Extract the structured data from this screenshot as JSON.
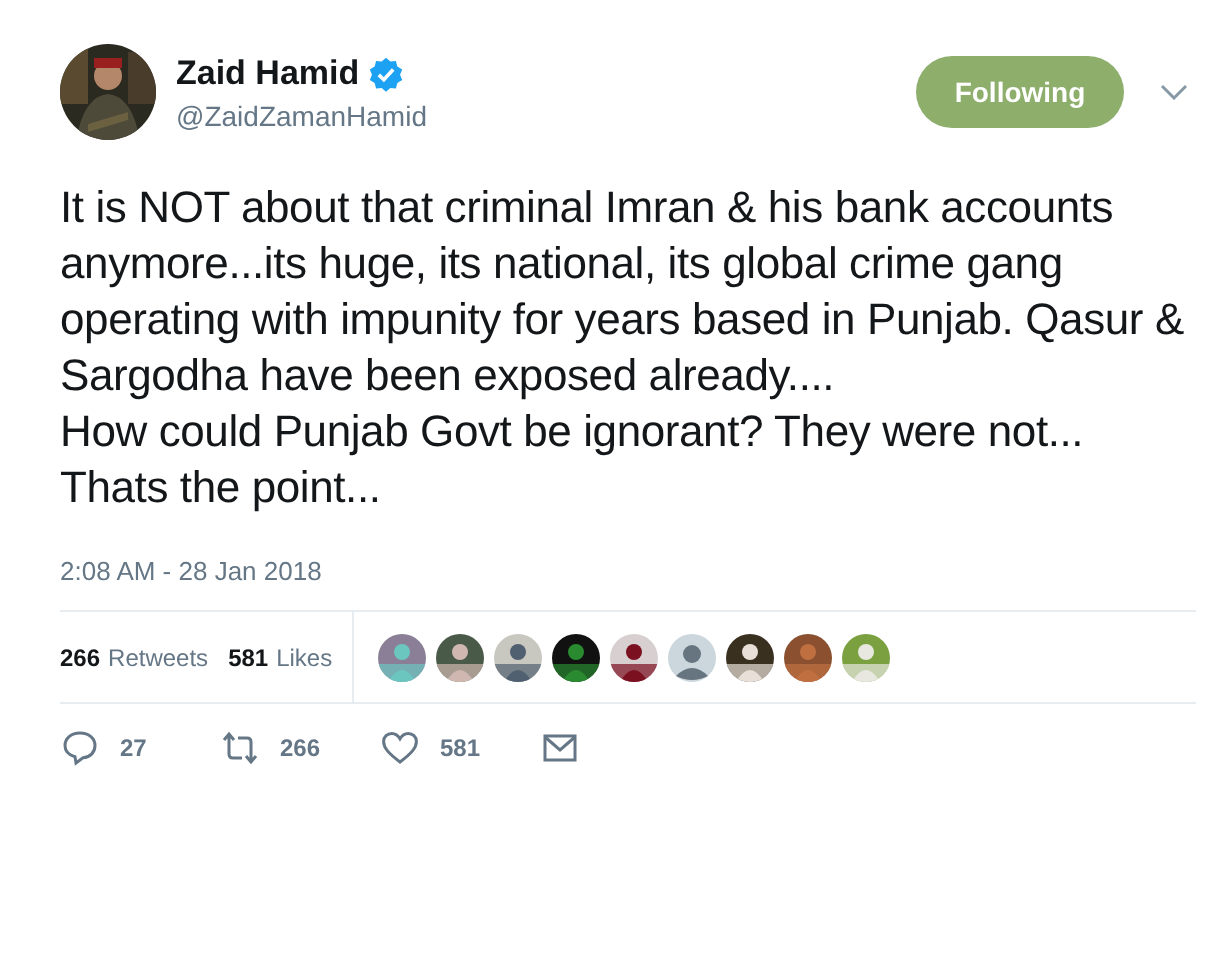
{
  "author": {
    "name": "Zaid Hamid",
    "verified": true,
    "handle": "@ZaidZamanHamid"
  },
  "follow_button": {
    "label": "Following",
    "selected": true
  },
  "tweet_text": [
    "It is NOT about that criminal Imran & his bank accounts anymore...its huge, its national, its global crime gang operating with impunity for years based in Punjab. Qasur & Sargodha have been exposed already....",
    "How could Punjab Govt be ignorant? They were not...",
    "Thats the point..."
  ],
  "timestamp": "2:08 AM - 28 Jan 2018",
  "stats": [
    {
      "count": "266",
      "label": "Retweets"
    },
    {
      "count": "581",
      "label": "Likes"
    }
  ],
  "liker_avatars": [
    {
      "kind": "picture"
    },
    {
      "kind": "picture"
    },
    {
      "kind": "picture"
    },
    {
      "kind": "picture"
    },
    {
      "kind": "picture"
    },
    {
      "kind": "default"
    },
    {
      "kind": "picture"
    },
    {
      "kind": "picture"
    },
    {
      "kind": "picture"
    }
  ],
  "actions": [
    {
      "kind": "reply",
      "count": "27"
    },
    {
      "kind": "retweet",
      "count": "266"
    },
    {
      "kind": "like",
      "count": "581"
    },
    {
      "kind": "message"
    }
  ]
}
